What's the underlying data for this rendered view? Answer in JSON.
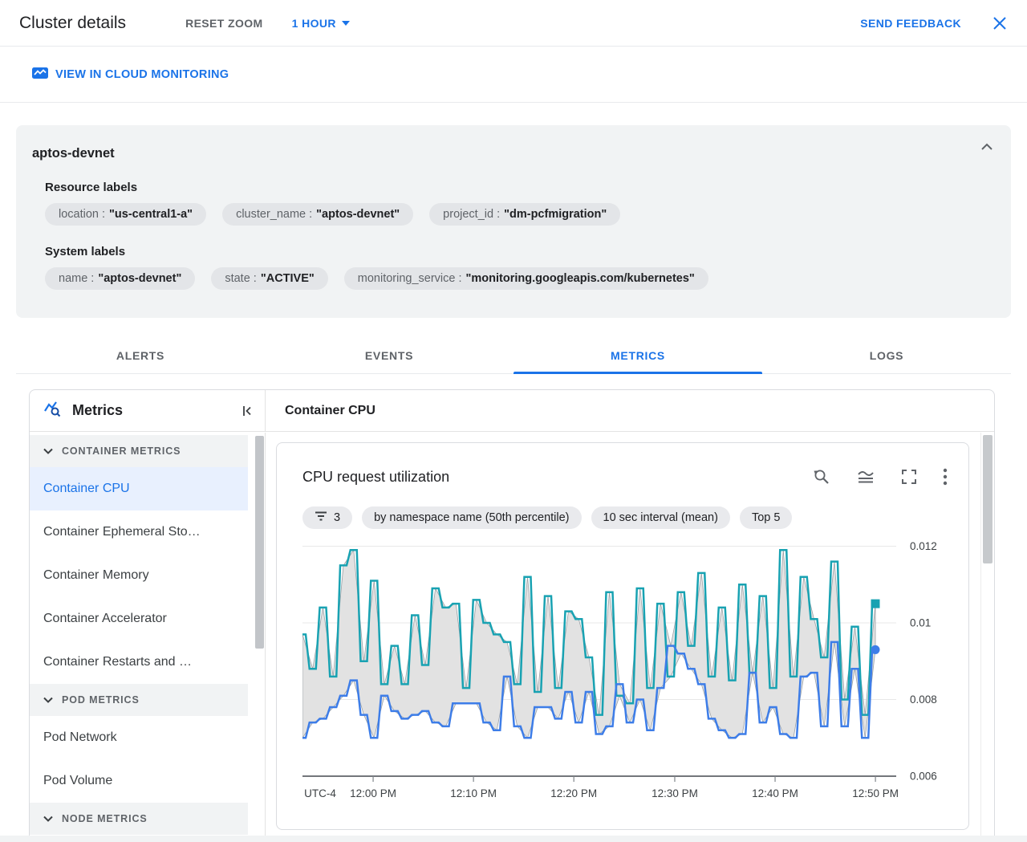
{
  "header": {
    "title": "Cluster details",
    "reset_zoom_label": "RESET ZOOM",
    "time_range_label": "1 HOUR",
    "send_feedback_label": "SEND FEEDBACK"
  },
  "monitoring_link": {
    "label": "VIEW IN CLOUD MONITORING"
  },
  "cluster": {
    "name": "aptos-devnet",
    "resource_labels_heading": "Resource labels",
    "resource_labels": [
      {
        "key": "location :",
        "value": "\"us-central1-a\""
      },
      {
        "key": "cluster_name :",
        "value": "\"aptos-devnet\""
      },
      {
        "key": "project_id :",
        "value": "\"dm-pcfmigration\""
      }
    ],
    "system_labels_heading": "System labels",
    "system_labels": [
      {
        "key": "name :",
        "value": "\"aptos-devnet\""
      },
      {
        "key": "state :",
        "value": "\"ACTIVE\""
      },
      {
        "key": "monitoring_service :",
        "value": "\"monitoring.googleapis.com/kubernetes\""
      }
    ]
  },
  "tabs": [
    {
      "label": "ALERTS",
      "active": false
    },
    {
      "label": "EVENTS",
      "active": false
    },
    {
      "label": "METRICS",
      "active": true
    },
    {
      "label": "LOGS",
      "active": false
    }
  ],
  "sidebar": {
    "title": "Metrics",
    "sections": [
      {
        "label": "CONTAINER METRICS",
        "items": [
          {
            "label": "Container CPU",
            "selected": true
          },
          {
            "label": "Container Ephemeral Sto…",
            "selected": false
          },
          {
            "label": "Container Memory",
            "selected": false
          },
          {
            "label": "Container Accelerator",
            "selected": false
          },
          {
            "label": "Container Restarts and …",
            "selected": false
          }
        ]
      },
      {
        "label": "POD METRICS",
        "items": [
          {
            "label": "Pod Network",
            "selected": false
          },
          {
            "label": "Pod Volume",
            "selected": false
          }
        ]
      },
      {
        "label": "NODE METRICS",
        "items": []
      }
    ]
  },
  "content": {
    "heading": "Container CPU",
    "card": {
      "title": "CPU request utilization",
      "toolbar_icons": [
        "zoom-reset-icon",
        "chart-type-icon",
        "fullscreen-icon",
        "more-options-icon"
      ],
      "chips": [
        {
          "icon": "filter-list-icon",
          "label": "3"
        },
        {
          "label": "by namespace name (50th percentile)"
        },
        {
          "label": "10 sec interval (mean)"
        },
        {
          "label": "Top 5"
        }
      ]
    }
  },
  "chart_data": {
    "type": "line",
    "title": "CPU request utilization",
    "grid": true,
    "legend": "none",
    "ylim": [
      0.006,
      0.0123
    ],
    "y_axis": {
      "ticks": [
        {
          "label": "0.012",
          "value": 0.012
        },
        {
          "label": "0.01",
          "value": 0.01
        },
        {
          "label": "0.008",
          "value": 0.008
        },
        {
          "label": "0.006",
          "value": 0.006
        }
      ],
      "gridline_values": [
        0.008,
        0.01,
        0.012
      ]
    },
    "x_axis": {
      "timezone_label": "UTC-4",
      "ticks": [
        {
          "label": "12:00 PM",
          "pos": 0.119
        },
        {
          "label": "12:10 PM",
          "pos": 0.288
        },
        {
          "label": "12:20 PM",
          "pos": 0.457
        },
        {
          "label": "12:30 PM",
          "pos": 0.627
        },
        {
          "label": "12:40 PM",
          "pos": 0.796
        },
        {
          "label": "12:50 PM",
          "pos": 0.965
        }
      ]
    },
    "band": {
      "fill": "#e2e2e2",
      "stroke": "#9aa0a6",
      "description": "min-max envelope between the two series"
    },
    "series": [
      {
        "name": "upper (50th percentile)",
        "color": "#18a2b2",
        "marker": "square",
        "values": [
          0.0097,
          0.0088,
          0.0104,
          0.0086,
          0.0115,
          0.0119,
          0.009,
          0.0111,
          0.0084,
          0.0094,
          0.0084,
          0.0102,
          0.0089,
          0.0109,
          0.0104,
          0.0105,
          0.0083,
          0.0106,
          0.01,
          0.0097,
          0.0095,
          0.0084,
          0.0112,
          0.0082,
          0.0107,
          0.0083,
          0.0103,
          0.0101,
          0.0091,
          0.0076,
          0.0108,
          0.0081,
          0.0079,
          0.0109,
          0.0083,
          0.0105,
          0.0086,
          0.0108,
          0.0094,
          0.0113,
          0.0086,
          0.0104,
          0.0085,
          0.011,
          0.0087,
          0.0107,
          0.0083,
          0.0119,
          0.0086,
          0.0112,
          0.0101,
          0.0091,
          0.0116,
          0.008,
          0.0099,
          0.0076,
          0.0105
        ]
      },
      {
        "name": "lower (50th percentile)",
        "color": "#3d7de8",
        "marker": "circle",
        "values": [
          0.007,
          0.0074,
          0.0075,
          0.0078,
          0.0081,
          0.0085,
          0.0076,
          0.007,
          0.0081,
          0.0077,
          0.0075,
          0.0076,
          0.0077,
          0.0074,
          0.0073,
          0.0079,
          0.0079,
          0.0079,
          0.0074,
          0.0072,
          0.0086,
          0.0073,
          0.007,
          0.0078,
          0.0078,
          0.0075,
          0.0082,
          0.0074,
          0.0082,
          0.0071,
          0.0073,
          0.0084,
          0.0074,
          0.008,
          0.0072,
          0.0083,
          0.0094,
          0.0092,
          0.0088,
          0.0084,
          0.0075,
          0.0072,
          0.007,
          0.0071,
          0.0087,
          0.0074,
          0.0078,
          0.0071,
          0.007,
          0.0086,
          0.0087,
          0.0073,
          0.0095,
          0.0073,
          0.0088,
          0.007,
          0.0093
        ]
      }
    ]
  }
}
